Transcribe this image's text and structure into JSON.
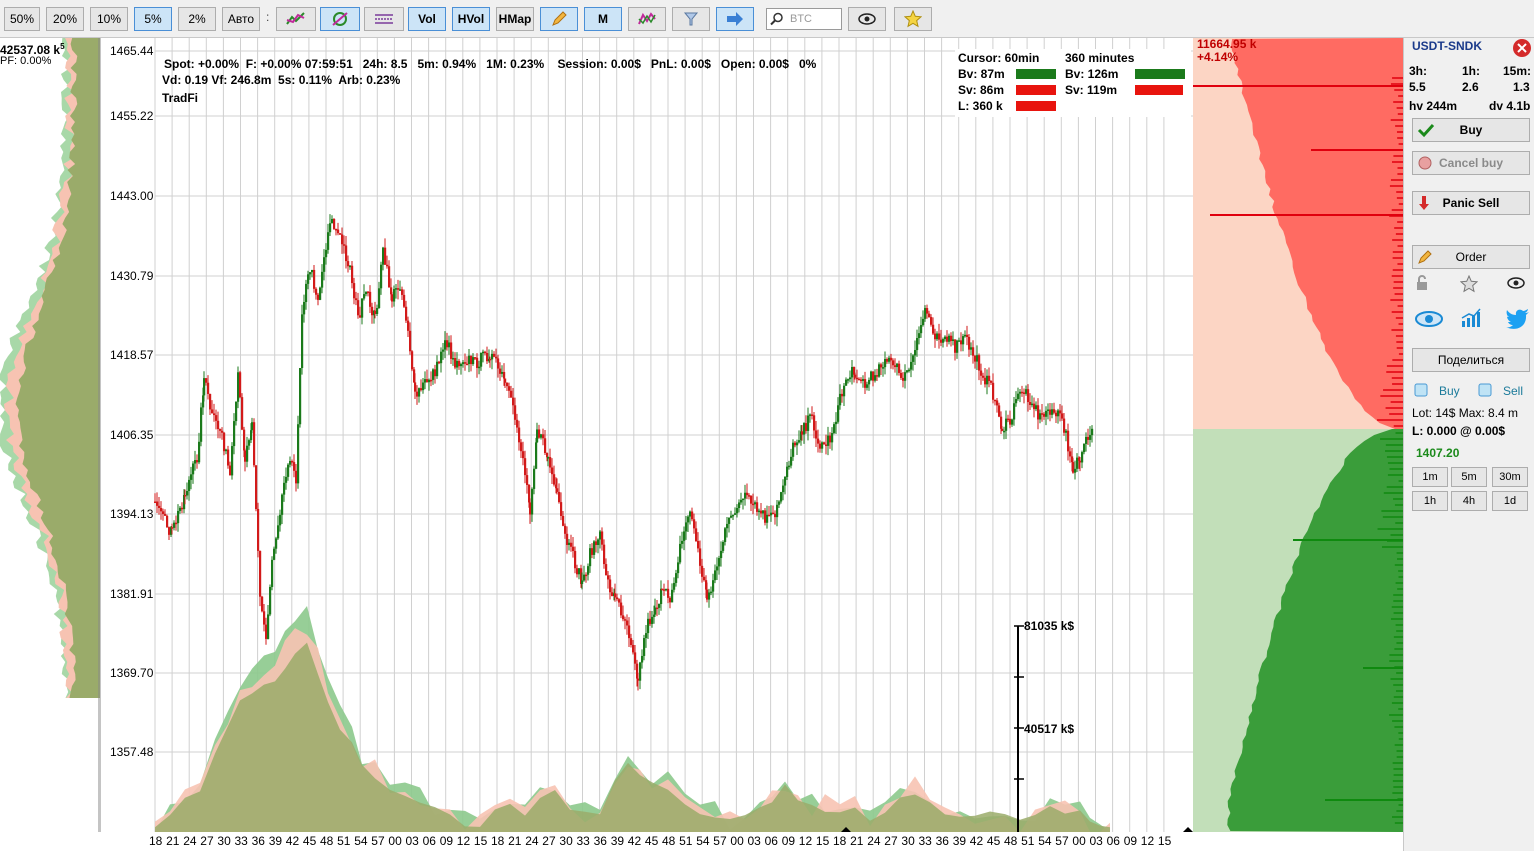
{
  "toolbar": {
    "zoom_buttons": [
      "50%",
      "20%",
      "10%",
      "5%",
      "2%",
      "Авто"
    ],
    "separator": ":",
    "vol_label": "Vol",
    "hvol_label": "HVol",
    "hmap_label": "HMap",
    "m_label": "M",
    "search_placeholder": "BTC",
    "icons": [
      "chart-lines-icon",
      "indicator-icon",
      "lines-icon",
      "pencil-icon",
      "colored-chart-icon",
      "filter-icon",
      "arrow-right-icon",
      "search-icon",
      "eye-icon",
      "star-icon"
    ]
  },
  "left_panel": {
    "label_value": "42537.08 k",
    "label_super": "5",
    "label_pf": "PF: 0.00%"
  },
  "chart": {
    "price_labels": [
      "1465.44",
      "1455.22",
      "1443.00",
      "1430.79",
      "1418.57",
      "1406.35",
      "1394.13",
      "1381.91",
      "1369.70",
      "1357.48"
    ],
    "info_line1": "Spot: +0.00%  F: +0.00% 07:59:51   24h: 8.5   5m: 0.94%   1M: 0.23%    Session: 0.00$   PnL: 0.00$   Open: 0.00$   0%",
    "info_line2": "Vd: 0.19 Vf: 246.8m  5s: 0.11%  Arb: 0.23%",
    "info_line3": "TradFi",
    "legend": {
      "cursor": "Cursor: 60min",
      "minutes": "360 minutes",
      "bv_left": "Bv: 87m",
      "sv_left": "Sv: 86m",
      "l_left": "L: 360 k",
      "bv_right": "Bv: 126m",
      "sv_right": "Sv: 119m"
    },
    "volume_labels": [
      "81035 k$",
      "40517 k$"
    ],
    "x_labels": [
      "18",
      "21",
      "24",
      "27",
      "30",
      "33",
      "36",
      "39",
      "42",
      "45",
      "48",
      "51",
      "54",
      "57",
      "00",
      "03",
      "06",
      "09",
      "12",
      "15",
      "18",
      "21",
      "24",
      "27",
      "30",
      "33",
      "36",
      "39",
      "42",
      "45",
      "48",
      "51",
      "54",
      "57",
      "00",
      "03",
      "06",
      "09",
      "12",
      "15",
      "18",
      "21",
      "24",
      "27",
      "30",
      "33",
      "36",
      "39",
      "42",
      "45",
      "48",
      "51",
      "54",
      "57",
      "00",
      "03",
      "06",
      "09",
      "12",
      "15"
    ],
    "colors": {
      "up": "#1b7a1b",
      "down": "#d21a1a",
      "grid": "#d0d0d0",
      "vol_green": "#8cc98c",
      "vol_pink": "#f7c3b2",
      "vol_olive": "#9aab6a"
    }
  },
  "orderbook": {
    "price": "11664.95 k",
    "percent": "+4.14%",
    "colors": {
      "ask_light": "#fcd5c4",
      "ask": "#ff6b62",
      "bid_light": "#c2dfb9",
      "bid": "#3a9d3a",
      "ask_line": "#e0000e",
      "bid_line": "#0f8a0f"
    }
  },
  "right_panel": {
    "symbol": "USDT-SNDK",
    "tf_labels": [
      "3h:",
      "1h:",
      "15m:"
    ],
    "tf_values": [
      "5.5",
      "2.6",
      "1.3"
    ],
    "hv": "hv 244m",
    "dv": "dv 4.1b",
    "buy_label": "Buy",
    "cancel_buy_label": "Cancel buy",
    "panic_sell_label": "Panic Sell",
    "order_label": "Order",
    "share_label": "Поделиться",
    "buy_small": "Buy",
    "sell_small": "Sell",
    "lot": "Lot: 14$  Max: 8.4 m",
    "position": "L: 0.000 @ 0.00$",
    "last_price": "1407.20",
    "timeframes": [
      "1m",
      "5m",
      "30m",
      "1h",
      "4h",
      "1d"
    ]
  }
}
